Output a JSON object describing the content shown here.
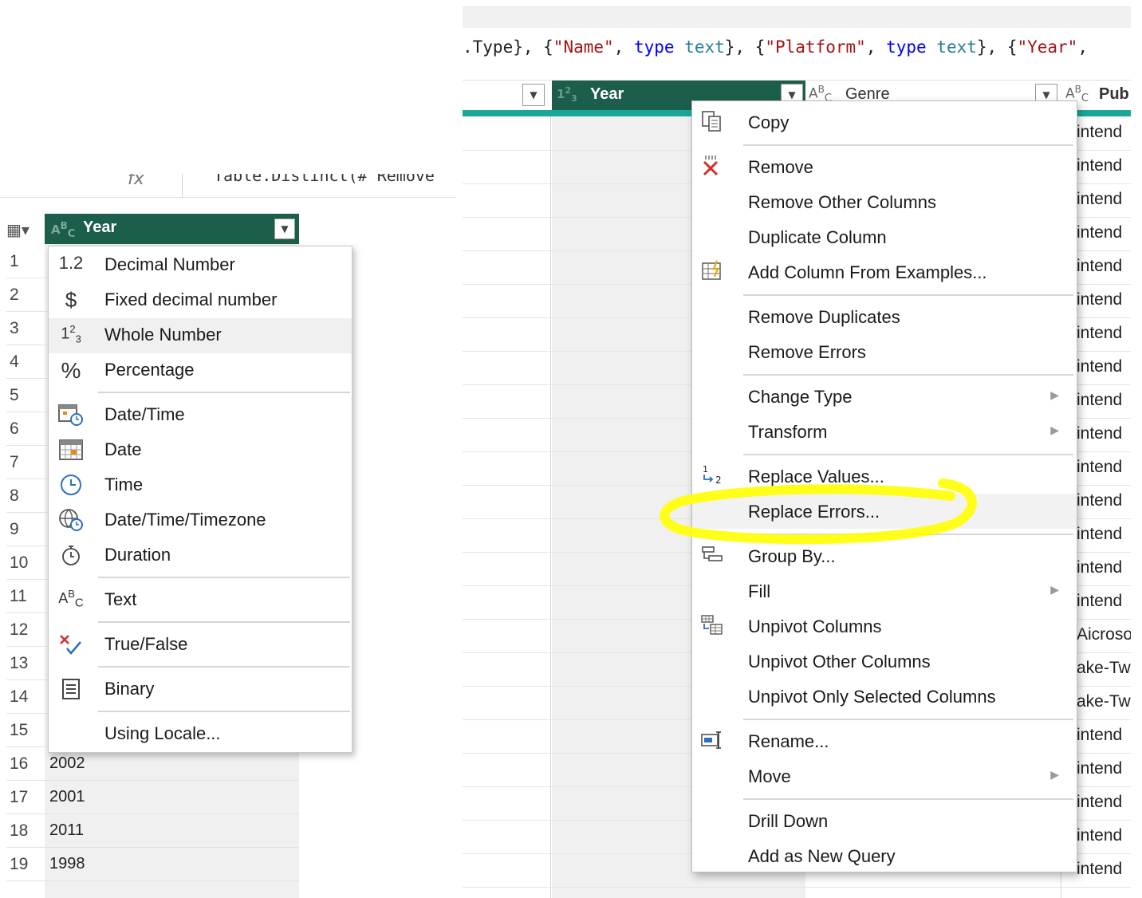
{
  "left": {
    "formula_text": "Table.Distinct(#\"Remove",
    "fx_label": "fx",
    "column_header": {
      "type_badge": "ABC",
      "name": "Year"
    },
    "row_numbers": [
      "1",
      "2",
      "3",
      "4",
      "5",
      "6",
      "7",
      "8",
      "9",
      "10",
      "11",
      "12",
      "13",
      "14",
      "15",
      "16",
      "17",
      "18",
      "19"
    ],
    "visible_values": [
      {
        "row": "16",
        "value": "2002"
      },
      {
        "row": "17",
        "value": "2001"
      },
      {
        "row": "18",
        "value": "2011"
      },
      {
        "row": "19",
        "value": "1998"
      }
    ],
    "type_menu": [
      {
        "icon": "1.2",
        "label": "Decimal Number"
      },
      {
        "icon": "$",
        "label": "Fixed decimal number"
      },
      {
        "icon": "1²₃",
        "label": "Whole Number",
        "highlighted": true
      },
      {
        "icon": "%",
        "label": "Percentage"
      },
      {
        "icon": "datetime",
        "label": "Date/Time"
      },
      {
        "icon": "date",
        "label": "Date"
      },
      {
        "icon": "time",
        "label": "Time"
      },
      {
        "icon": "timezone",
        "label": "Date/Time/Timezone"
      },
      {
        "icon": "duration",
        "label": "Duration"
      },
      {
        "icon": "ABC",
        "label": "Text"
      },
      {
        "icon": "truefalse",
        "label": "True/False"
      },
      {
        "icon": "binary",
        "label": "Binary"
      },
      {
        "icon": "",
        "label": "Using Locale..."
      }
    ]
  },
  "right": {
    "formula": {
      "p1": ".Type}, {",
      "s1": "\"Name\"",
      "p2": ", ",
      "k1": "type",
      "p3": " ",
      "t1": "text",
      "p4": "}, {",
      "s2": "\"Platform\"",
      "p5": ", ",
      "k2": "type",
      "p6": " ",
      "t2": "text",
      "p7": "}, {",
      "s3": "\"Year\"",
      "p8": ","
    },
    "headers": {
      "year": {
        "type_badge": "1²₃",
        "name": "Year"
      },
      "genre": {
        "type_badge": "ABC",
        "name": "Genre"
      },
      "publisher": {
        "type_badge": "ABC",
        "name": "Pub"
      }
    },
    "publisher_values": [
      "intend",
      "intend",
      "intend",
      "intend",
      "intend",
      "intend",
      "intend",
      "intend",
      "intend",
      "intend",
      "intend",
      "intend",
      "intend",
      "intend",
      "intend",
      "Aicroso",
      "ake-Tw",
      "ake-Tw",
      "intend",
      "intend",
      "intend",
      "intend",
      "intend"
    ],
    "context_menu": [
      {
        "icon": "copy",
        "label": "Copy"
      },
      {
        "icon": "remove",
        "label": "Remove"
      },
      {
        "icon": "",
        "label": "Remove Other Columns"
      },
      {
        "icon": "",
        "label": "Duplicate Column"
      },
      {
        "icon": "add-column",
        "label": "Add Column From Examples..."
      },
      {
        "icon": "",
        "label": "Remove Duplicates"
      },
      {
        "icon": "",
        "label": "Remove Errors"
      },
      {
        "icon": "",
        "label": "Change Type",
        "submenu": true
      },
      {
        "icon": "",
        "label": "Transform",
        "submenu": true
      },
      {
        "icon": "replace",
        "label": "Replace Values..."
      },
      {
        "icon": "",
        "label": "Replace Errors...",
        "highlighted": true
      },
      {
        "icon": "group",
        "label": "Group By..."
      },
      {
        "icon": "",
        "label": "Fill",
        "submenu": true
      },
      {
        "icon": "unpivot",
        "label": "Unpivot Columns"
      },
      {
        "icon": "",
        "label": "Unpivot Other Columns"
      },
      {
        "icon": "",
        "label": "Unpivot Only Selected Columns"
      },
      {
        "icon": "rename",
        "label": "Rename..."
      },
      {
        "icon": "",
        "label": "Move",
        "submenu": true
      },
      {
        "icon": "",
        "label": "Drill Down"
      },
      {
        "icon": "",
        "label": "Add as New Query"
      }
    ]
  },
  "colors": {
    "header_green": "#1b5e4b",
    "accent_teal": "#1aa79a",
    "annotation_yellow": "#ffff00"
  }
}
